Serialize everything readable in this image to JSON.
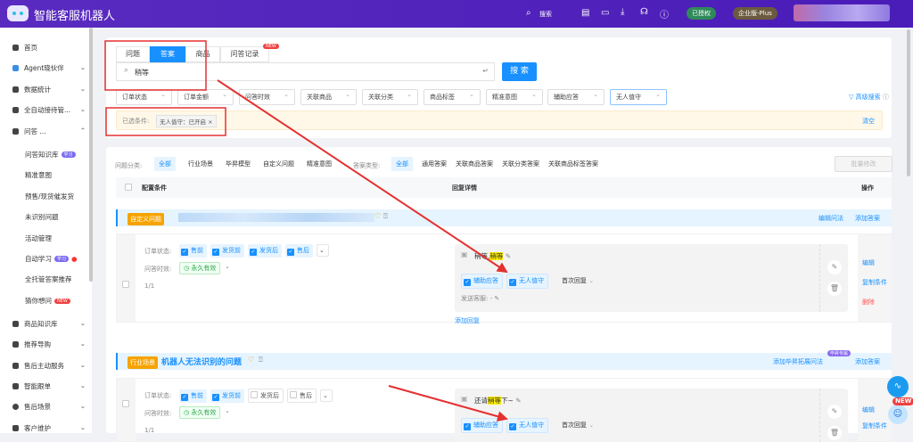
{
  "header": {
    "app_title": "智能客服机器人",
    "search_label": "搜索",
    "authorized_badge": "已授权",
    "edition_badge": "企业版-Plus",
    "colors": {
      "header": "#5128bd",
      "accent": "#1890ff"
    }
  },
  "sidebar": {
    "items": [
      {
        "label": "首页",
        "icon": "home-icon"
      },
      {
        "label": "Agent晓伙伴",
        "icon": "agent-icon",
        "chevron": "⌄"
      },
      {
        "label": "数据统计",
        "icon": "chart-icon",
        "chevron": "⌄"
      },
      {
        "label": "全自动接待管...",
        "icon": "robot-icon",
        "chevron": "⌄"
      },
      {
        "label": "问答 ...",
        "icon": "chat-icon",
        "chevron": "⌃"
      }
    ],
    "sub_items": [
      {
        "label": "问答知识库",
        "badge": "学习"
      },
      {
        "label": "精准意图"
      },
      {
        "label": "预售/现货催发货"
      },
      {
        "label": "未识别问题"
      },
      {
        "label": "活动管理"
      },
      {
        "label": "自动学习",
        "badge": "学习"
      },
      {
        "label": "全托管答案推荐"
      },
      {
        "label": "猜你想问",
        "badge": "NEW"
      }
    ],
    "more_items": [
      {
        "label": "商品知识库"
      },
      {
        "label": "推荐导购"
      },
      {
        "label": "售后主动服务"
      },
      {
        "label": "智能跟单"
      },
      {
        "label": "售后场景"
      },
      {
        "label": "客户维护"
      }
    ]
  },
  "search_card": {
    "tabs": [
      {
        "label": "问题"
      },
      {
        "label": "答案",
        "active": true
      },
      {
        "label": "商品"
      },
      {
        "label": "问答记录",
        "badge": "NEW"
      }
    ],
    "query": "稍等",
    "enter_hint": "↵",
    "search_button": "搜 索",
    "filters": [
      "订单状态",
      "订单金额",
      "问答时效",
      "关联商品",
      "关联分类",
      "商品标签",
      "精准意图",
      "辅助应答",
      "无人值守"
    ],
    "advanced_search": "高级搜索",
    "selected_label": "已选条件:",
    "selected_chip": "无人值守：已开启",
    "clear": "清空"
  },
  "list": {
    "question_category_label": "问题分类:",
    "question_categories": [
      "全部",
      "行业场景",
      "毕昇模型",
      "自定义问题",
      "精准意图"
    ],
    "answer_type_label": "答案类型:",
    "answer_types": [
      "全部",
      "通用答案",
      "关联商品答案",
      "关联分类答案",
      "关联商品标签答案"
    ],
    "batch_edit": "批量修改",
    "col_conditions": "配置条件",
    "col_reply": "回复详情",
    "col_actions": "操作",
    "groups": [
      {
        "tag": "自定义问题",
        "title": "",
        "links": [
          "编辑问法",
          "添加答案"
        ],
        "order_status_label": "订单状态:",
        "order_status": [
          {
            "label": "售前",
            "checked": true
          },
          {
            "label": "发货前",
            "checked": true
          },
          {
            "label": "发货后",
            "checked": true
          },
          {
            "label": "售后",
            "checked": true
          }
        ],
        "validity_label": "问答时效:",
        "validity": "永久有效",
        "page": "1/1",
        "reply_prefix": "稍等,",
        "reply_hl": "稍等",
        "reply_suffix": "",
        "assist": "辅助应答",
        "unattended": "无人值守",
        "reply_mode": "首次回复",
        "send_label": "发送客服:",
        "send_value": "-",
        "add_reply": "添加回复",
        "actions": [
          "编辑",
          "复制条件",
          "删除"
        ]
      },
      {
        "tag": "行业场景",
        "title": "机器人无法识别的问题",
        "links": [
          "添加毕昇拓展问法",
          "添加答案"
        ],
        "links_badge": "毕昇专属",
        "order_status_label": "订单状态:",
        "order_status": [
          {
            "label": "售前",
            "checked": true
          },
          {
            "label": "发货前",
            "checked": true
          },
          {
            "label": "发货后",
            "checked": false
          },
          {
            "label": "售后",
            "checked": false
          }
        ],
        "validity_label": "问答时效:",
        "validity": "永久有效",
        "page": "1/1",
        "reply_prefix": "还请",
        "reply_hl": "稍等",
        "reply_suffix": "下~",
        "assist": "辅助应答",
        "unattended": "无人值守",
        "reply_mode": "首次回复",
        "actions": [
          "编辑",
          "复制条件"
        ]
      }
    ]
  },
  "float": {
    "new_badge": "NEW"
  }
}
